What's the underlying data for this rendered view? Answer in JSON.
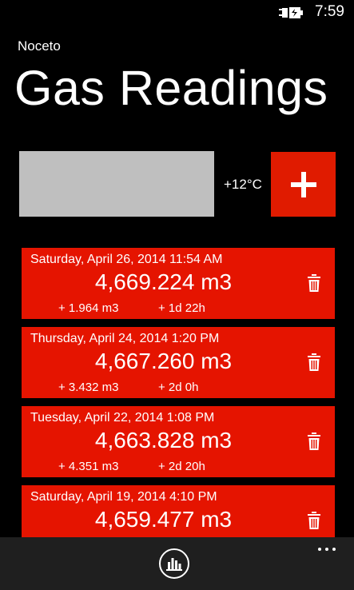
{
  "status": {
    "time": "7:59",
    "battery_icon": "battery-charging-icon"
  },
  "header": {
    "app_name": "Noceto",
    "title": "Gas Readings"
  },
  "entry": {
    "reading_value": "",
    "temperature": "+12°C",
    "add_icon": "plus-icon"
  },
  "readings": [
    {
      "date": "Saturday, April 26, 2014 11:54 AM",
      "value": "4,669.224 m3",
      "delta": "+ 1.964 m3",
      "elapsed": "+ 1d 22h"
    },
    {
      "date": "Thursday, April 24, 2014 1:20 PM",
      "value": "4,667.260 m3",
      "delta": "+ 3.432 m3",
      "elapsed": "+ 2d 0h"
    },
    {
      "date": "Tuesday, April 22, 2014 1:08 PM",
      "value": "4,663.828 m3",
      "delta": "+ 4.351 m3",
      "elapsed": "+ 2d 20h"
    },
    {
      "date": "Saturday, April 19, 2014 4:10 PM",
      "value": "4,659.477 m3",
      "delta": "",
      "elapsed": ""
    }
  ],
  "appbar": {
    "stats_icon": "bar-chart-icon",
    "more_icon": "ellipsis-icon"
  },
  "colors": {
    "accent": "#e51400",
    "background": "#000000",
    "input": "#bfbfbf",
    "appbar": "#1f1f1f"
  }
}
